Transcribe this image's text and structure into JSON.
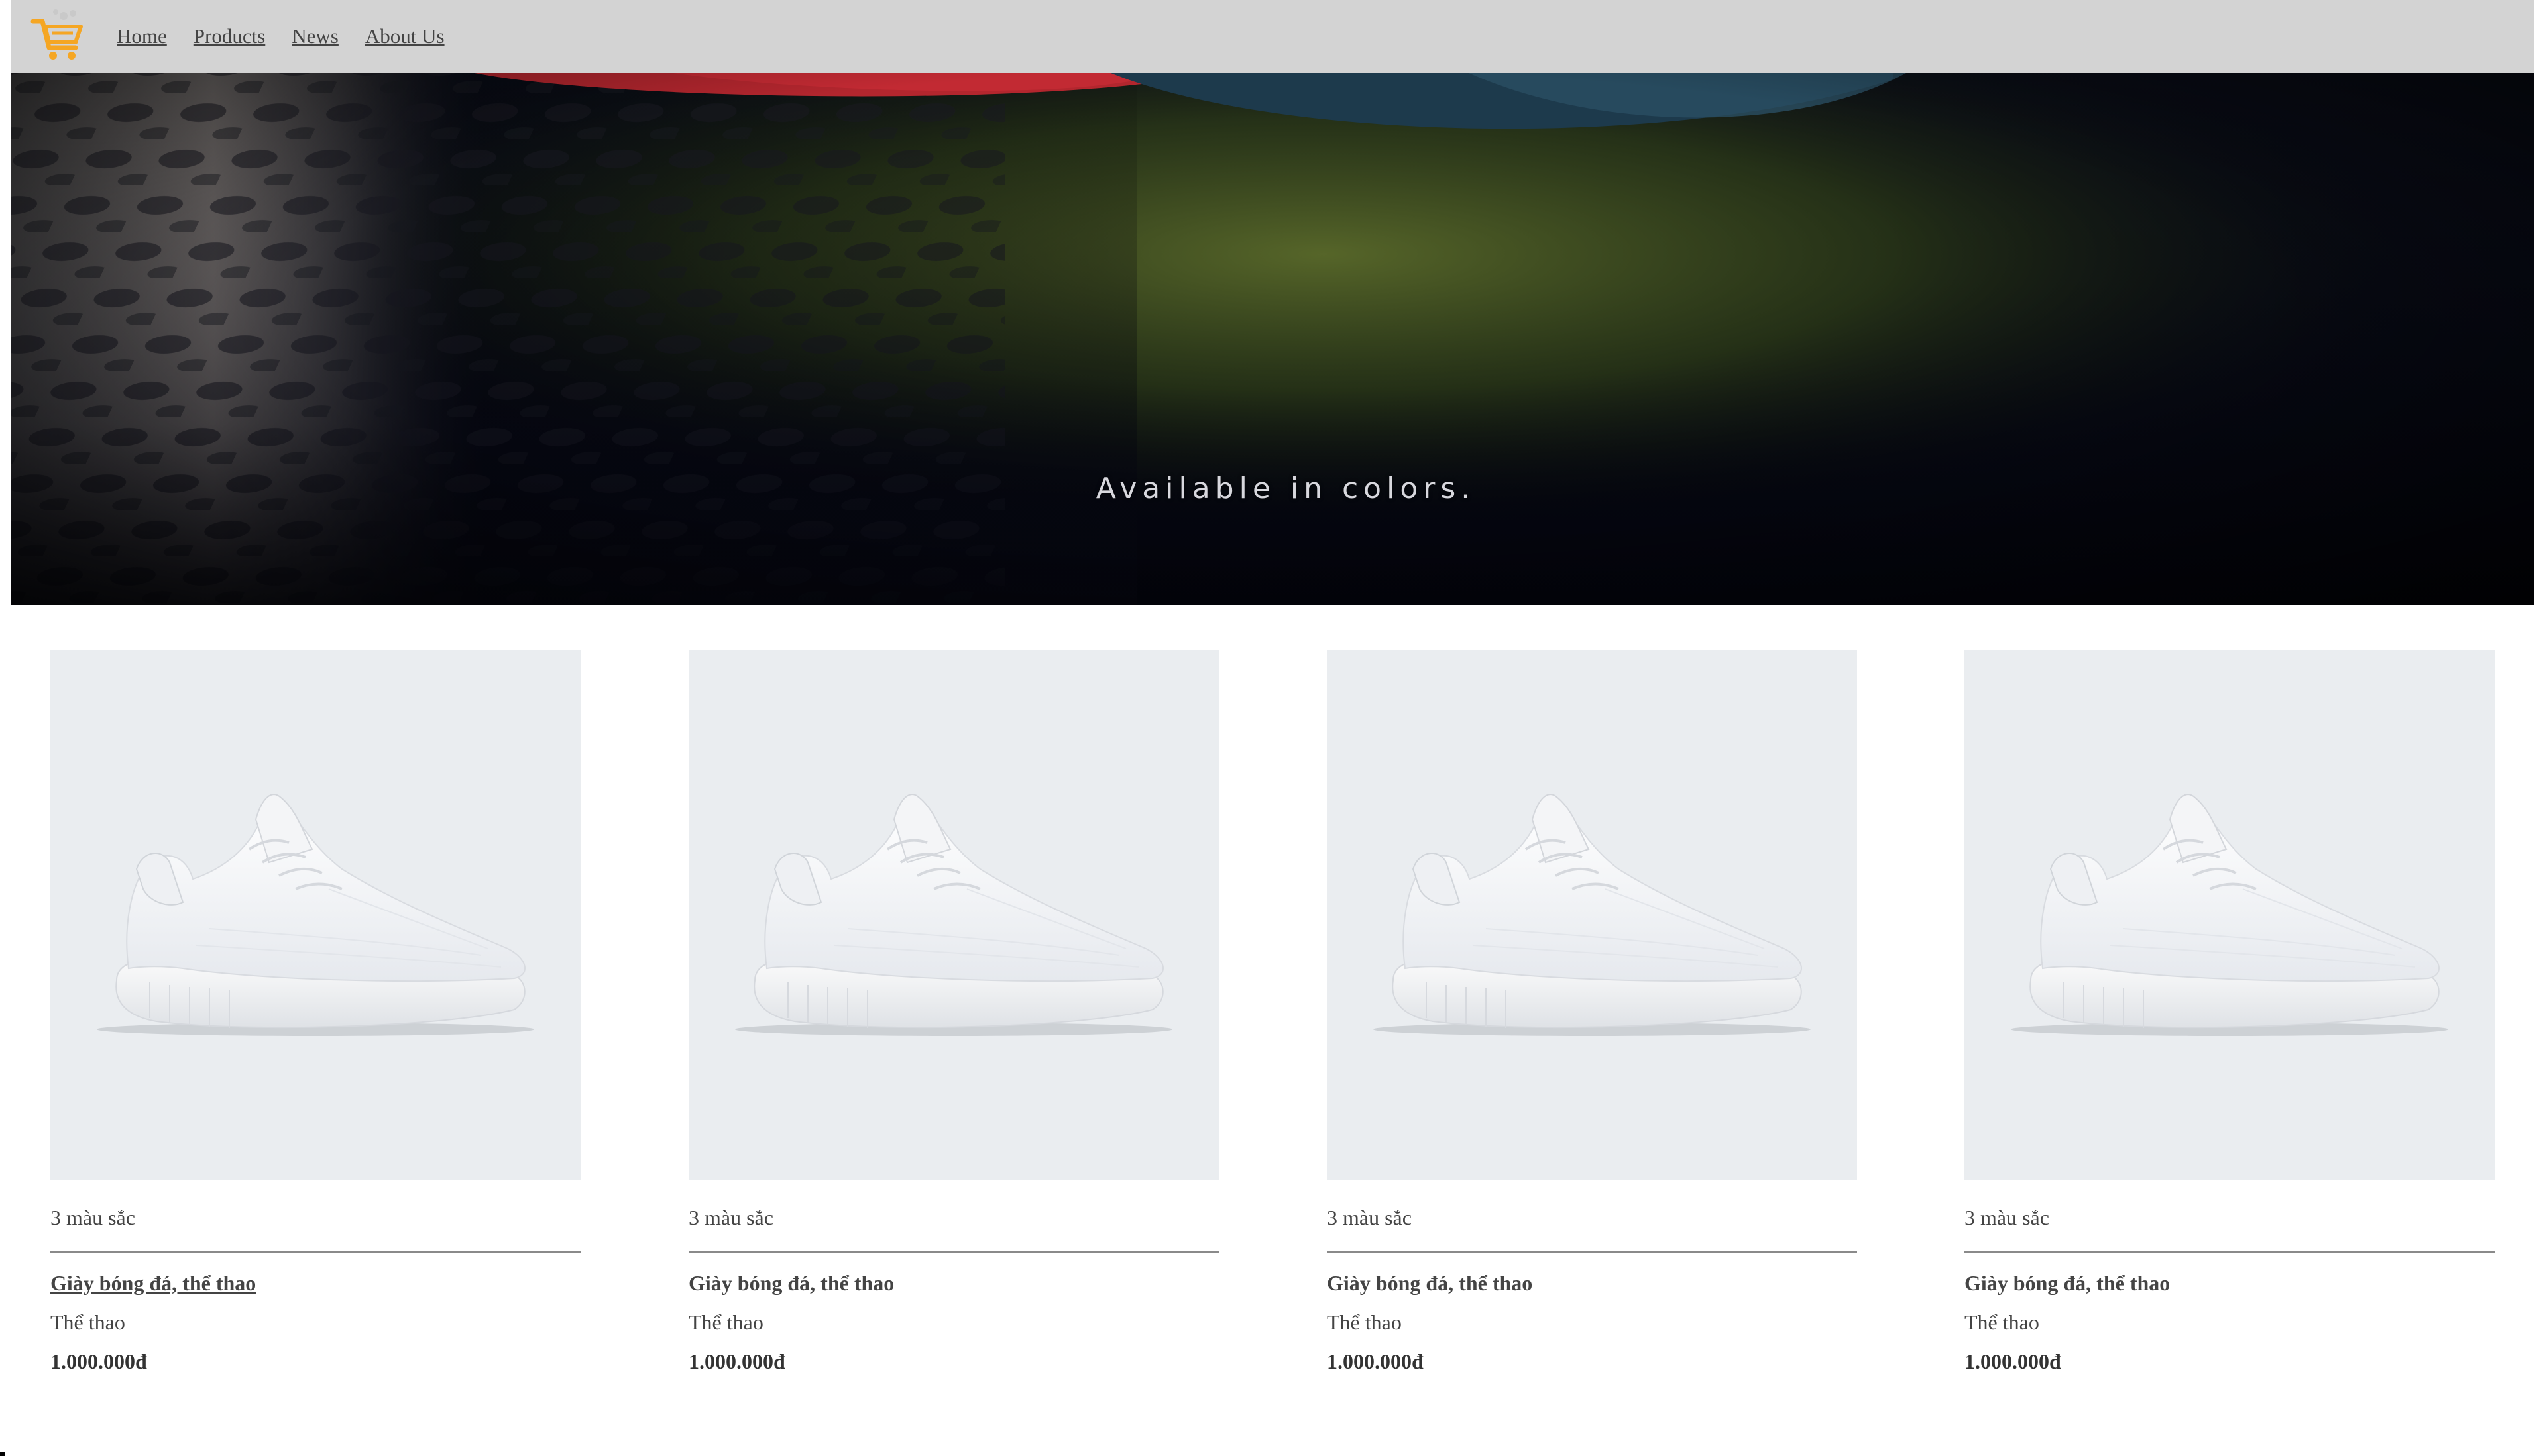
{
  "nav": {
    "logo_icon": "shopping-cart-icon",
    "links": [
      "Home",
      "Products",
      "News",
      "About Us"
    ]
  },
  "hero": {
    "caption": "Available in colors."
  },
  "products": [
    {
      "colors": "3 màu sắc",
      "name": "Giày bóng đá, thể thao",
      "category": "Thể thao",
      "price": "1.000.000đ"
    },
    {
      "colors": "3 màu sắc",
      "name": "Giày bóng đá, thể thao",
      "category": "Thể thao",
      "price": "1.000.000đ"
    },
    {
      "colors": "3 màu sắc",
      "name": "Giày bóng đá, thể thao",
      "category": "Thể thao",
      "price": "1.000.000đ"
    },
    {
      "colors": "3 màu sắc",
      "name": "Giày bóng đá, thể thao",
      "category": "Thể thao",
      "price": "1.000.000đ"
    }
  ],
  "colors": {
    "navbar_bg": "#d3d3d3",
    "logo_accent": "#f5a623",
    "product_bg": "#eaedf0"
  }
}
